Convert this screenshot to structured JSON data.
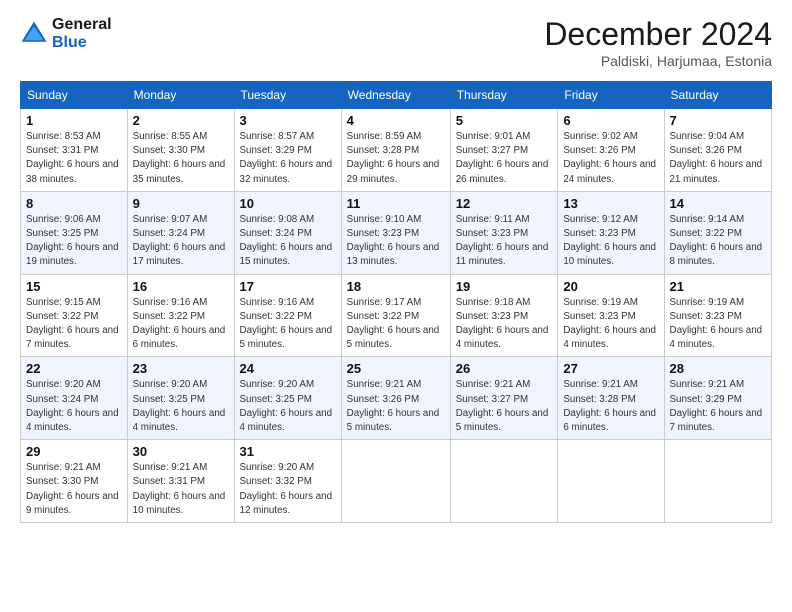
{
  "header": {
    "logo_line1": "General",
    "logo_line2": "Blue",
    "month_title": "December 2024",
    "location": "Paldiski, Harjumaa, Estonia"
  },
  "days_of_week": [
    "Sunday",
    "Monday",
    "Tuesday",
    "Wednesday",
    "Thursday",
    "Friday",
    "Saturday"
  ],
  "weeks": [
    [
      {
        "day": "1",
        "sunrise": "8:53 AM",
        "sunset": "3:31 PM",
        "daylight": "6 hours and 38 minutes."
      },
      {
        "day": "2",
        "sunrise": "8:55 AM",
        "sunset": "3:30 PM",
        "daylight": "6 hours and 35 minutes."
      },
      {
        "day": "3",
        "sunrise": "8:57 AM",
        "sunset": "3:29 PM",
        "daylight": "6 hours and 32 minutes."
      },
      {
        "day": "4",
        "sunrise": "8:59 AM",
        "sunset": "3:28 PM",
        "daylight": "6 hours and 29 minutes."
      },
      {
        "day": "5",
        "sunrise": "9:01 AM",
        "sunset": "3:27 PM",
        "daylight": "6 hours and 26 minutes."
      },
      {
        "day": "6",
        "sunrise": "9:02 AM",
        "sunset": "3:26 PM",
        "daylight": "6 hours and 24 minutes."
      },
      {
        "day": "7",
        "sunrise": "9:04 AM",
        "sunset": "3:26 PM",
        "daylight": "6 hours and 21 minutes."
      }
    ],
    [
      {
        "day": "8",
        "sunrise": "9:06 AM",
        "sunset": "3:25 PM",
        "daylight": "6 hours and 19 minutes."
      },
      {
        "day": "9",
        "sunrise": "9:07 AM",
        "sunset": "3:24 PM",
        "daylight": "6 hours and 17 minutes."
      },
      {
        "day": "10",
        "sunrise": "9:08 AM",
        "sunset": "3:24 PM",
        "daylight": "6 hours and 15 minutes."
      },
      {
        "day": "11",
        "sunrise": "9:10 AM",
        "sunset": "3:23 PM",
        "daylight": "6 hours and 13 minutes."
      },
      {
        "day": "12",
        "sunrise": "9:11 AM",
        "sunset": "3:23 PM",
        "daylight": "6 hours and 11 minutes."
      },
      {
        "day": "13",
        "sunrise": "9:12 AM",
        "sunset": "3:23 PM",
        "daylight": "6 hours and 10 minutes."
      },
      {
        "day": "14",
        "sunrise": "9:14 AM",
        "sunset": "3:22 PM",
        "daylight": "6 hours and 8 minutes."
      }
    ],
    [
      {
        "day": "15",
        "sunrise": "9:15 AM",
        "sunset": "3:22 PM",
        "daylight": "6 hours and 7 minutes."
      },
      {
        "day": "16",
        "sunrise": "9:16 AM",
        "sunset": "3:22 PM",
        "daylight": "6 hours and 6 minutes."
      },
      {
        "day": "17",
        "sunrise": "9:16 AM",
        "sunset": "3:22 PM",
        "daylight": "6 hours and 5 minutes."
      },
      {
        "day": "18",
        "sunrise": "9:17 AM",
        "sunset": "3:22 PM",
        "daylight": "6 hours and 5 minutes."
      },
      {
        "day": "19",
        "sunrise": "9:18 AM",
        "sunset": "3:23 PM",
        "daylight": "6 hours and 4 minutes."
      },
      {
        "day": "20",
        "sunrise": "9:19 AM",
        "sunset": "3:23 PM",
        "daylight": "6 hours and 4 minutes."
      },
      {
        "day": "21",
        "sunrise": "9:19 AM",
        "sunset": "3:23 PM",
        "daylight": "6 hours and 4 minutes."
      }
    ],
    [
      {
        "day": "22",
        "sunrise": "9:20 AM",
        "sunset": "3:24 PM",
        "daylight": "6 hours and 4 minutes."
      },
      {
        "day": "23",
        "sunrise": "9:20 AM",
        "sunset": "3:25 PM",
        "daylight": "6 hours and 4 minutes."
      },
      {
        "day": "24",
        "sunrise": "9:20 AM",
        "sunset": "3:25 PM",
        "daylight": "6 hours and 4 minutes."
      },
      {
        "day": "25",
        "sunrise": "9:21 AM",
        "sunset": "3:26 PM",
        "daylight": "6 hours and 5 minutes."
      },
      {
        "day": "26",
        "sunrise": "9:21 AM",
        "sunset": "3:27 PM",
        "daylight": "6 hours and 5 minutes."
      },
      {
        "day": "27",
        "sunrise": "9:21 AM",
        "sunset": "3:28 PM",
        "daylight": "6 hours and 6 minutes."
      },
      {
        "day": "28",
        "sunrise": "9:21 AM",
        "sunset": "3:29 PM",
        "daylight": "6 hours and 7 minutes."
      }
    ],
    [
      {
        "day": "29",
        "sunrise": "9:21 AM",
        "sunset": "3:30 PM",
        "daylight": "6 hours and 9 minutes."
      },
      {
        "day": "30",
        "sunrise": "9:21 AM",
        "sunset": "3:31 PM",
        "daylight": "6 hours and 10 minutes."
      },
      {
        "day": "31",
        "sunrise": "9:20 AM",
        "sunset": "3:32 PM",
        "daylight": "6 hours and 12 minutes."
      },
      null,
      null,
      null,
      null
    ]
  ]
}
